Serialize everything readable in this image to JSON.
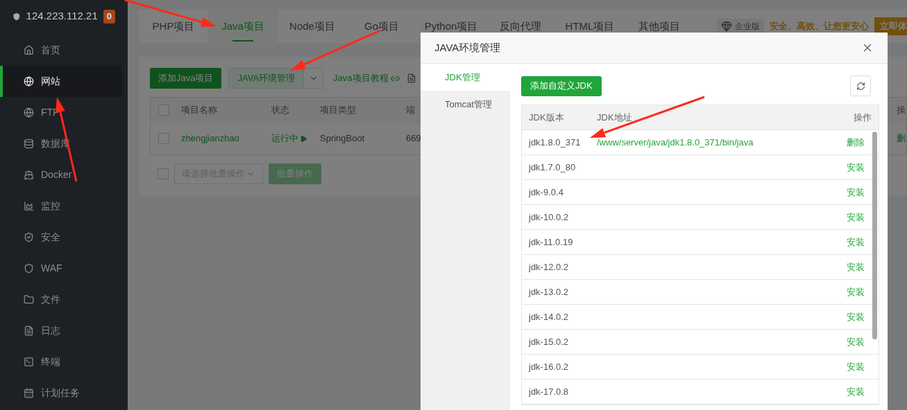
{
  "sidebar": {
    "server": "124.223.112.21",
    "badge": "0",
    "items": [
      {
        "label": "首页",
        "selected": false
      },
      {
        "label": "网站",
        "selected": true
      },
      {
        "label": "FTP",
        "selected": false
      },
      {
        "label": "数据库",
        "selected": false
      },
      {
        "label": "Docker",
        "selected": false
      },
      {
        "label": "监控",
        "selected": false
      },
      {
        "label": "安全",
        "selected": false
      },
      {
        "label": "WAF",
        "selected": false
      },
      {
        "label": "文件",
        "selected": false
      },
      {
        "label": "日志",
        "selected": false
      },
      {
        "label": "终端",
        "selected": false
      },
      {
        "label": "计划任务",
        "selected": false
      }
    ]
  },
  "tabs": [
    {
      "label": "PHP项目",
      "selected": false
    },
    {
      "label": "Java项目",
      "selected": true
    },
    {
      "label": "Node项目",
      "selected": false
    },
    {
      "label": "Go项目",
      "selected": false
    },
    {
      "label": "Python项目",
      "selected": false
    },
    {
      "label": "反向代理",
      "selected": false
    },
    {
      "label": "HTML项目",
      "selected": false
    },
    {
      "label": "其他项目",
      "selected": false
    }
  ],
  "promo": {
    "edition": "企业版",
    "slogan": "安全、高效、让您更安心",
    "button": "立即体"
  },
  "toolbar": {
    "add_button": "添加Java项目",
    "env_button": "JAVA环境管理",
    "tutorial_link": "Java项目教程"
  },
  "projects": {
    "all_checked": false,
    "columns": [
      "项目名称",
      "状态",
      "项目类型",
      "端",
      "操"
    ],
    "rows": [
      {
        "checked": false,
        "name": "zhengjianzhao",
        "status": "运行中",
        "type": "SpringBoot",
        "port": "669",
        "action": "删"
      }
    ],
    "batch_checked": false,
    "batch_placeholder": "请选择批量操作",
    "batch_button": "批量操作"
  },
  "dialog": {
    "title": "JAVA环境管理",
    "nav": [
      {
        "label": "JDK管理",
        "selected": true
      },
      {
        "label": "Tomcat管理",
        "selected": false
      }
    ],
    "add_button": "添加自定义JDK",
    "columns": [
      "JDK版本",
      "JDK地址",
      "操作"
    ],
    "rows": [
      {
        "version": "jdk1.8.0_371",
        "path": "/www/server/java/jdk1.8.0_371/bin/java",
        "action": "删除"
      },
      {
        "version": "jdk1.7.0_80",
        "action": "安装"
      },
      {
        "version": "jdk-9.0.4",
        "action": "安装"
      },
      {
        "version": "jdk-10.0.2",
        "action": "安装"
      },
      {
        "version": "jdk-11.0.19",
        "action": "安装"
      },
      {
        "version": "jdk-12.0.2",
        "action": "安装"
      },
      {
        "version": "jdk-13.0.2",
        "action": "安装"
      },
      {
        "version": "jdk-14.0.2",
        "action": "安装"
      },
      {
        "version": "jdk-15.0.2",
        "action": "安装"
      },
      {
        "version": "jdk-16.0.2",
        "action": "安装"
      },
      {
        "version": "jdk-17.0.8",
        "action": "安装"
      }
    ]
  }
}
